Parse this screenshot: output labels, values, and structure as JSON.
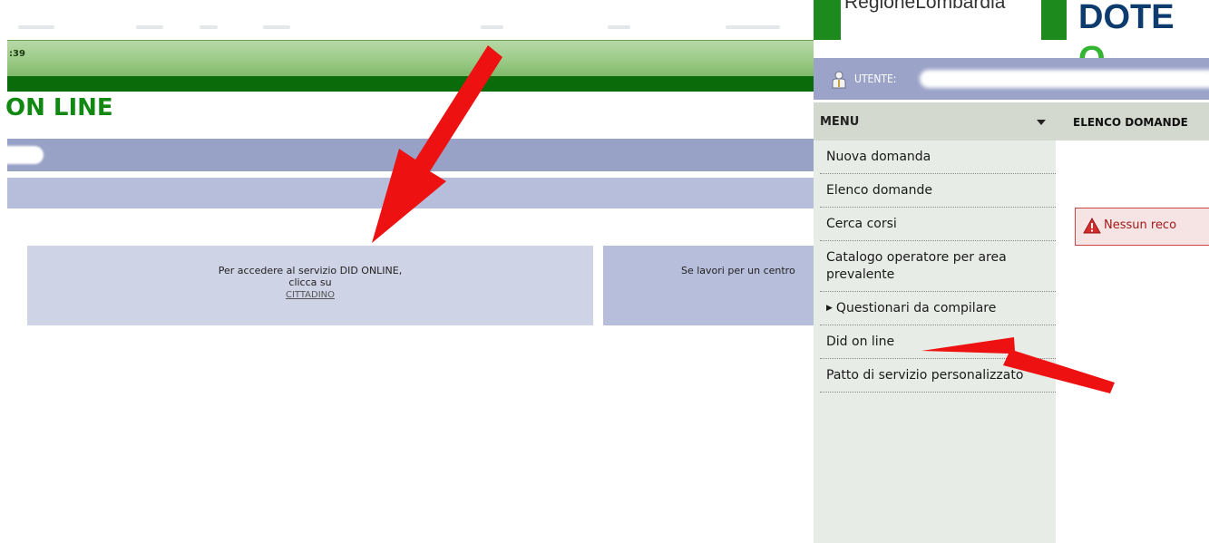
{
  "left_panel": {
    "clock": ":39",
    "page_title": "ON LINE",
    "citizen_box": {
      "line1": "Per accedere al servizio DID ONLINE,",
      "line2": "clicca su",
      "link": "CITTADINO"
    },
    "operator_box": {
      "text": "Se lavori per un centro"
    }
  },
  "right_panel": {
    "logo_text": "RegioneLombardia",
    "app_title": "DOTE",
    "app_title_accent": "O",
    "user_label": "UTENTE:",
    "menu": {
      "header": "MENU",
      "items": [
        {
          "label": "Nuova domanda"
        },
        {
          "label": "Elenco domande"
        },
        {
          "label": "Cerca corsi"
        },
        {
          "label": "Catalogo operatore per area prevalente"
        },
        {
          "label": "Questionari da compilare",
          "expandable": true
        },
        {
          "label": "Did on line"
        },
        {
          "label": "Patto di servizio personalizzato"
        }
      ]
    },
    "content_header": "ELENCO DOMANDE",
    "alert_text": "Nessun reco"
  },
  "annotations": {
    "arrow_color": "#ee1111"
  },
  "colors": {
    "green_bar": "#9ccb88",
    "dark_green": "#0a6b0a",
    "title_green": "#118811",
    "blue_bar": "#98a2c6",
    "light_blue": "#b7bedb",
    "menu_bg": "#e7ece6",
    "alert_red": "#c94444"
  }
}
